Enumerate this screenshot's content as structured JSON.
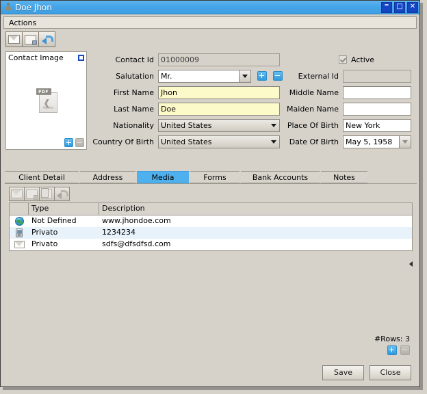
{
  "window": {
    "title": "Doe Jhon",
    "icon": "person-icon",
    "controls": [
      {
        "name": "minimize",
        "glyph": "–"
      },
      {
        "name": "maximize",
        "glyph": "□"
      },
      {
        "name": "close",
        "glyph": "✕"
      }
    ]
  },
  "menubar": {
    "items": [
      "Actions"
    ]
  },
  "toolbar": {
    "buttons": [
      {
        "name": "send-email-button",
        "icon": "envelope-icon"
      },
      {
        "name": "new-note-button",
        "icon": "note-icon"
      },
      {
        "name": "reply-button",
        "icon": "reply-arrow-icon"
      }
    ]
  },
  "image_panel": {
    "title": "Contact Image",
    "expand_icon": "square-icon",
    "thumbnail": {
      "label": "PDF",
      "brand": "Adobe"
    },
    "add_icon": "plus-icon",
    "remove_icon": "minus-icon"
  },
  "form": {
    "contact_id": {
      "label": "Contact Id",
      "value": "01000009"
    },
    "salutation": {
      "label": "Salutation",
      "value": "Mr.",
      "add_icon": "plus-icon",
      "remove_icon": "minus-icon"
    },
    "first_name": {
      "label": "First Name",
      "value": "Jhon"
    },
    "last_name": {
      "label": "Last Name",
      "value": "Doe"
    },
    "nationality": {
      "label": "Nationality",
      "value": "United States"
    },
    "country_of_birth": {
      "label": "Country Of Birth",
      "value": "United States"
    },
    "active": {
      "label": "Active",
      "checked": true
    },
    "external_id": {
      "label": "External Id",
      "value": ""
    },
    "middle_name": {
      "label": "Middle Name",
      "value": ""
    },
    "maiden_name": {
      "label": "Maiden Name",
      "value": ""
    },
    "place_of_birth": {
      "label": "Place Of Birth",
      "value": "New York"
    },
    "date_of_birth": {
      "label": "Date Of Birth",
      "value": "May 5, 1958"
    }
  },
  "tabs": {
    "active": "Media",
    "items": [
      {
        "label": "Client Detail",
        "name": "tab-client-detail"
      },
      {
        "label": "Address",
        "name": "tab-address"
      },
      {
        "label": "Media",
        "name": "tab-media"
      },
      {
        "label": "Forms",
        "name": "tab-forms"
      },
      {
        "label": "Bank Accounts",
        "name": "tab-bank-accounts"
      },
      {
        "label": "Notes",
        "name": "tab-notes"
      }
    ]
  },
  "media_toolbar": {
    "buttons": [
      {
        "name": "media-email-button",
        "icon": "envelope-icon"
      },
      {
        "name": "media-note-button",
        "icon": "note-icon"
      },
      {
        "name": "media-document-button",
        "icon": "document-icon"
      },
      {
        "name": "media-reply-button",
        "icon": "reply-arrow-icon"
      }
    ]
  },
  "grid": {
    "columns": [
      "",
      "Type",
      "Description"
    ],
    "rows": [
      {
        "icon": "globe-icon",
        "type": "Not Defined",
        "description": "www.jhondoe.com"
      },
      {
        "icon": "phone-icon",
        "type": "Privato",
        "description": "1234234"
      },
      {
        "icon": "envelope-icon",
        "type": "Privato",
        "description": "sdfs@dfsdfsd.com"
      }
    ],
    "collapse_icon": "triangle-left-icon"
  },
  "footer": {
    "rows_label": "#Rows: 3",
    "add_row_icon": "plus-icon",
    "remove_row_icon": "minus-icon",
    "save_label": "Save",
    "close_label": "Close"
  },
  "colors": {
    "titlebar": "#46a5e8",
    "accent": "#4fb0ee",
    "window_bg": "#d6d2ca",
    "highlight_field": "#fcfac8",
    "alt_row": "#e8f2fb"
  }
}
